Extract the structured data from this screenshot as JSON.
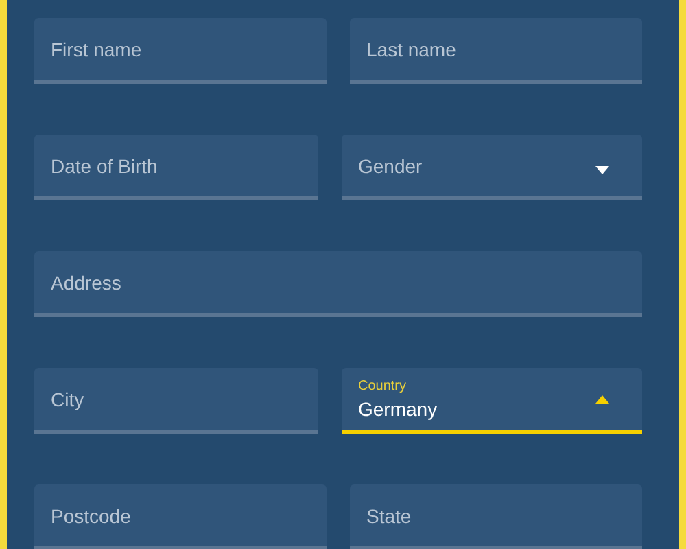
{
  "rows": [
    [
      {
        "kind": "text",
        "placeholder": "First name"
      },
      {
        "kind": "text",
        "placeholder": "Last name"
      }
    ],
    [
      {
        "kind": "text",
        "placeholder": "Date of Birth"
      },
      {
        "kind": "select",
        "placeholder": "Gender",
        "expanded": false,
        "focused": false
      }
    ],
    [
      {
        "kind": "text",
        "placeholder": "Address"
      }
    ],
    [
      {
        "kind": "text",
        "placeholder": "City"
      },
      {
        "kind": "select",
        "label": "Country",
        "value": "Germany",
        "expanded": true,
        "focused": true
      }
    ],
    [
      {
        "kind": "text",
        "placeholder": "Postcode"
      },
      {
        "kind": "text",
        "placeholder": "State"
      }
    ]
  ]
}
